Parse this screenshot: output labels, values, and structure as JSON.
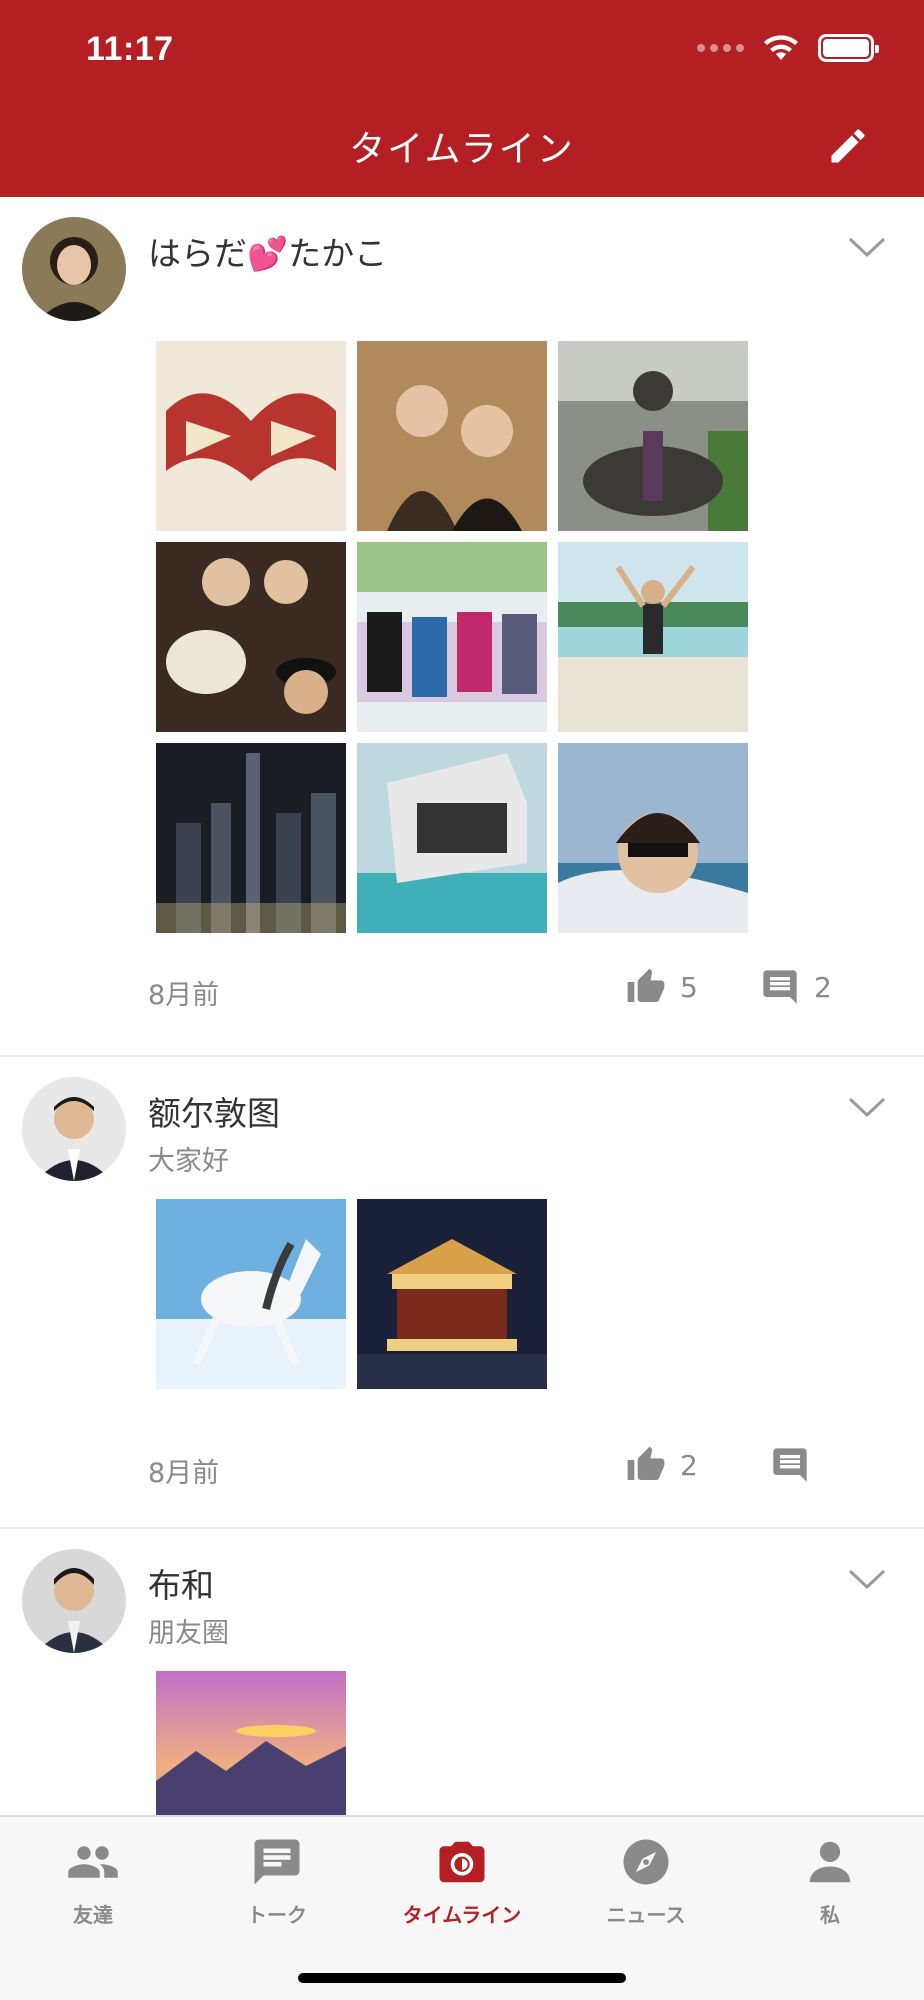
{
  "status_bar": {
    "time": "11:17"
  },
  "header": {
    "title": "タイムライン",
    "bg_color": "#b31f22",
    "edit_icon": "pencil-icon"
  },
  "posts": [
    {
      "name": "はらだ💕たかこ",
      "subtitle": "",
      "photos": [
        {
          "desc": "heart-art",
          "c1": "#f0e8d8",
          "c2": "#b8342e"
        },
        {
          "desc": "two-women",
          "c1": "#b08a5a",
          "c2": "#2b2018"
        },
        {
          "desc": "statue",
          "c1": "#8a8f88",
          "c2": "#3b3a36"
        },
        {
          "desc": "group-bouquet",
          "c1": "#3a2a22",
          "c2": "#e8e2d8"
        },
        {
          "desc": "group-sofa",
          "c1": "#e8eef0",
          "c2": "#3a3040"
        },
        {
          "desc": "beach-jump",
          "c1": "#cfe6ee",
          "c2": "#e9e3d6"
        },
        {
          "desc": "city-night",
          "c1": "#1a1e24",
          "c2": "#4b5260"
        },
        {
          "desc": "floating-house",
          "c1": "#bfd8e0",
          "c2": "#3fb0b8"
        },
        {
          "desc": "boat-selfie",
          "c1": "#9ab6d0",
          "c2": "#e8ecf0"
        }
      ],
      "time": "8月前",
      "likes": "5",
      "comments": "2"
    },
    {
      "name": "额尔敦图",
      "subtitle": "大家好",
      "photos": [
        {
          "desc": "white-horse",
          "c1": "#6eb0e0",
          "c2": "#e8f2fa"
        },
        {
          "desc": "carousel",
          "c1": "#1a1f3a",
          "c2": "#d9a24a"
        }
      ],
      "time": "8月前",
      "likes": "2",
      "comments": ""
    },
    {
      "name": "布和",
      "subtitle": "朋友圈",
      "photos": [
        {
          "desc": "mountain-sunrise",
          "c1": "#f0b080",
          "c2": "#4a4070"
        }
      ],
      "time": "",
      "likes": "",
      "comments": ""
    }
  ],
  "tabs": [
    {
      "label": "友達",
      "icon": "friends-icon"
    },
    {
      "label": "トーク",
      "icon": "chat-icon"
    },
    {
      "label": "タイムライン",
      "icon": "camera-icon",
      "active": true
    },
    {
      "label": "ニュース",
      "icon": "compass-icon"
    },
    {
      "label": "私",
      "icon": "person-icon"
    }
  ],
  "colors": {
    "accent": "#b31f22",
    "muted": "#8a8a8a"
  }
}
